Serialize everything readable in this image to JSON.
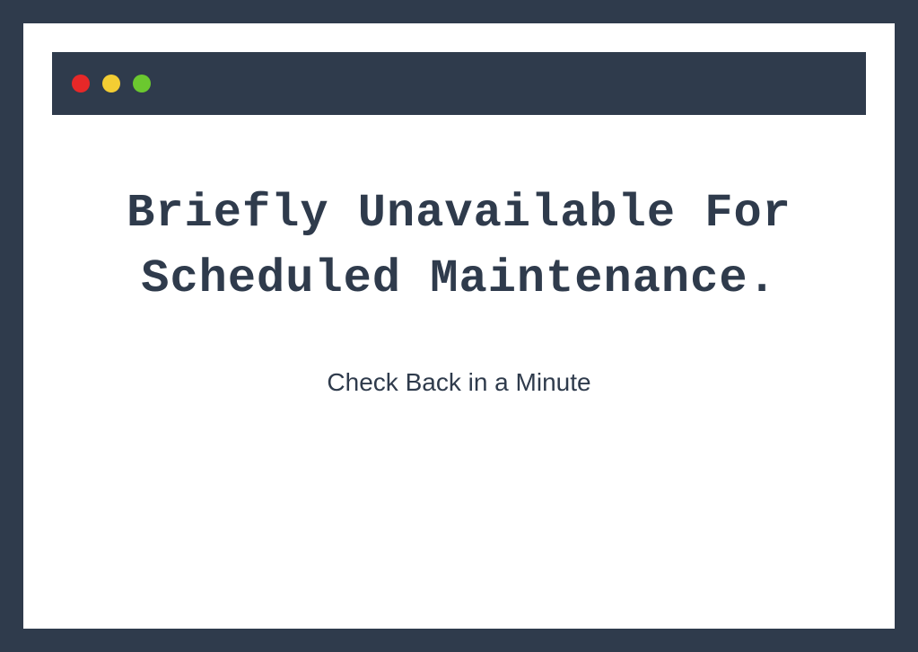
{
  "window": {
    "traffic_lights": {
      "close_color": "#e72828",
      "minimize_color": "#f3cd33",
      "maximize_color": "#6bc82f"
    }
  },
  "message": {
    "heading_line1": "Briefly Unavailable For",
    "heading_line2": "Scheduled Maintenance.",
    "subtext": "Check Back in a Minute"
  }
}
